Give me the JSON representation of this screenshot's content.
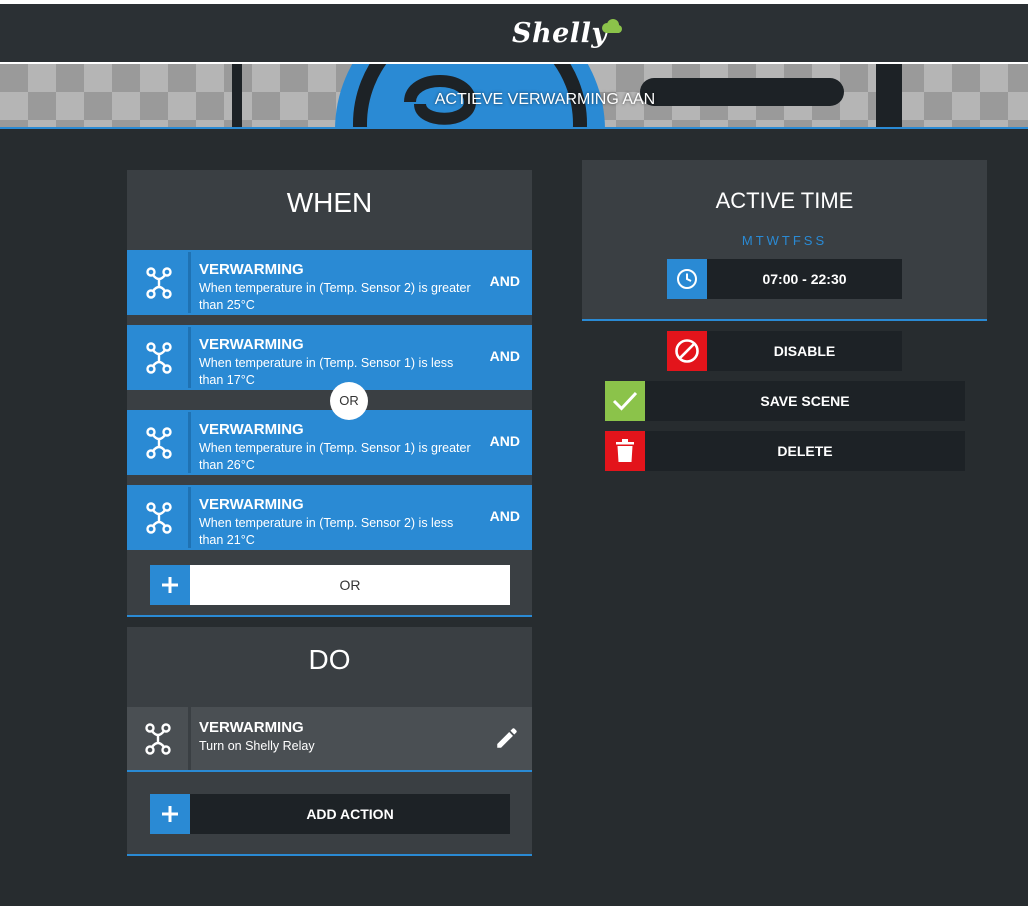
{
  "header": {
    "brand": "Shelly"
  },
  "banner": {
    "title": "ACTIEVE VERWARMING AAN"
  },
  "when": {
    "heading": "WHEN",
    "conditions": [
      {
        "title": "VERWARMING",
        "description": "When temperature in (Temp. Sensor 2) is greater than 25°C",
        "joiner": "AND"
      },
      {
        "title": "VERWARMING",
        "description": "When temperature in (Temp. Sensor 1) is less than 17°C",
        "joiner": "AND"
      },
      {
        "title": "VERWARMING",
        "description": "When temperature in (Temp. Sensor 1) is greater than 26°C",
        "joiner": "AND"
      },
      {
        "title": "VERWARMING",
        "description": "When temperature in (Temp. Sensor 2) is less than 21°C",
        "joiner": "AND"
      }
    ],
    "group_separator": "OR",
    "add_or_label": "OR"
  },
  "do": {
    "heading": "DO",
    "actions": [
      {
        "title": "VERWARMING",
        "description": "Turn on Shelly Relay"
      }
    ],
    "add_action_label": "ADD ACTION"
  },
  "active_time": {
    "heading": "ACTIVE TIME",
    "days": "MTWTFSS",
    "time_range": "07:00 - 22:30"
  },
  "buttons": {
    "disable": "DISABLE",
    "save_scene": "SAVE SCENE",
    "delete": "DELETE"
  },
  "colors": {
    "accent": "#2a8ad4",
    "danger": "#e3141b",
    "success": "#8bc34a",
    "background": "#272c2f",
    "panel": "#3a3f43"
  }
}
